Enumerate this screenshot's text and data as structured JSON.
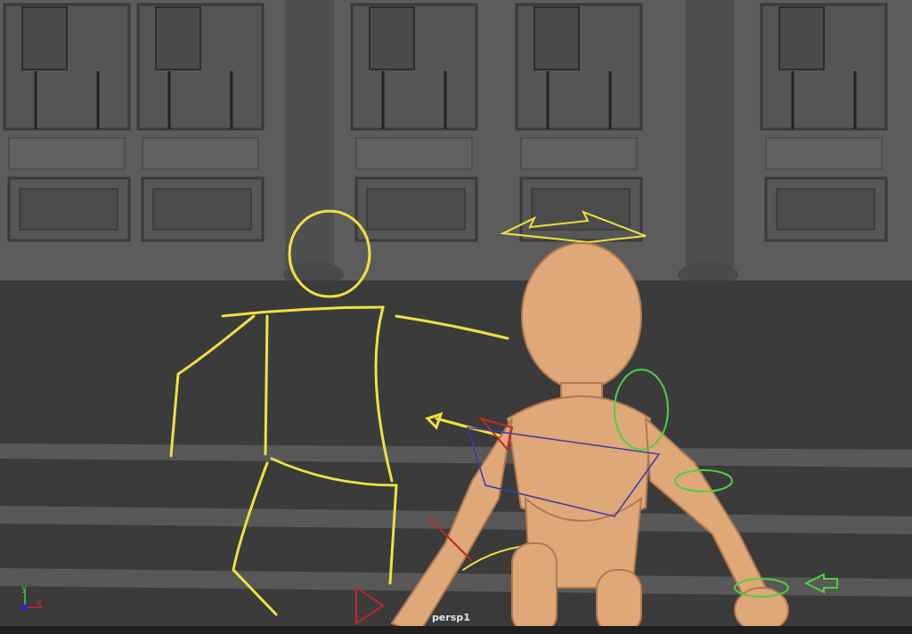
{
  "viewport": {
    "camera_label": "persp1",
    "axis": {
      "x_label": "x",
      "y_label": "y"
    }
  }
}
